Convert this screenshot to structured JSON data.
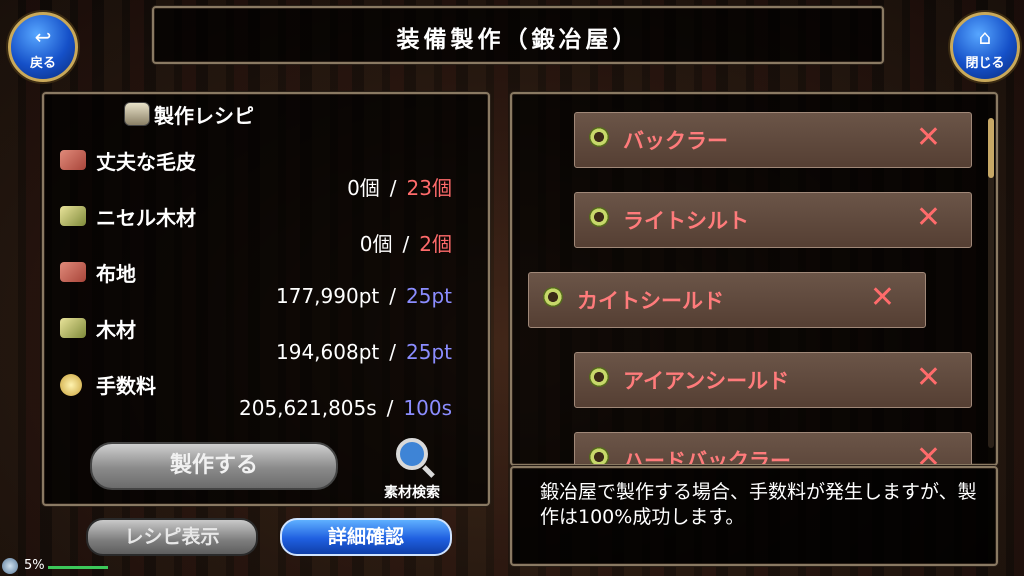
{
  "header": {
    "title": "装備製作（鍛冶屋）"
  },
  "nav": {
    "back_label": "戻る",
    "close_label": "閉じる"
  },
  "recipe": {
    "heading": "製作レシピ",
    "materials": [
      {
        "name": "丈夫な毛皮",
        "icon": "fur-icon",
        "have": "0個",
        "required": "23個",
        "req_color": "red"
      },
      {
        "name": "ニセル木材",
        "icon": "lumber-icon",
        "have": "0個",
        "required": "2個",
        "req_color": "red"
      },
      {
        "name": "布地",
        "icon": "cloth-icon",
        "have": "177,990pt",
        "required": "25pt",
        "req_color": "blue"
      },
      {
        "name": "木材",
        "icon": "wood-icon",
        "have": "194,608pt",
        "required": "25pt",
        "req_color": "blue"
      },
      {
        "name": "手数料",
        "icon": "coin-icon",
        "have": "205,621,805s",
        "required": "100s",
        "req_color": "blue"
      }
    ],
    "separator": "/",
    "craft_button": "製作する",
    "search_label": "素材検索"
  },
  "buttons": {
    "recipe_view": "レシピ表示",
    "detail": "詳細確認"
  },
  "equipment_list": {
    "items": [
      {
        "name": "バックラー",
        "mark": "✕"
      },
      {
        "name": "ライトシルト",
        "mark": "✕"
      },
      {
        "name": "カイトシールド",
        "mark": "✕"
      },
      {
        "name": "アイアンシールド",
        "mark": "✕"
      },
      {
        "name": "ハードバックラー",
        "mark": "✕"
      }
    ]
  },
  "info": {
    "text": "鍛冶屋で製作する場合、手数料が発生しますが、製作は100%成功します。"
  },
  "status": {
    "value": "5%"
  },
  "colors": {
    "req_red": "#ff6b6b",
    "req_blue": "#8b8dff",
    "item_name": "#ff7b7b",
    "frame": "#8a7a63"
  }
}
